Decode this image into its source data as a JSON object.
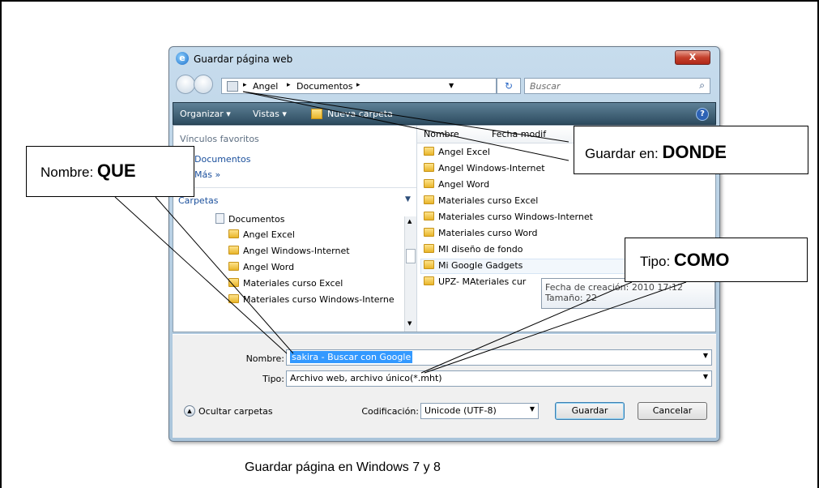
{
  "dialog": {
    "title": "Guardar página web",
    "close_glyph": "X",
    "address": {
      "segments": [
        "Angel",
        "Documentos"
      ],
      "sep": "▸"
    },
    "search_placeholder": "Buscar",
    "toolbar": {
      "organize": "Organizar ▾",
      "views": "Vistas ▾",
      "new_folder": "Nueva carpeta"
    },
    "favorites_header": "Vínculos favoritos",
    "favorites": [
      "Documentos",
      "Más »"
    ],
    "folders_header": "Carpetas",
    "tree": [
      "Documentos",
      "Angel Excel",
      "Angel Windows-Internet",
      "Angel Word",
      "Materiales curso Excel",
      "Materiales curso Windows-Interne"
    ],
    "columns": [
      "Nombre",
      "Fecha modif"
    ],
    "files": [
      "Angel Excel",
      "Angel Windows-Internet",
      "Angel Word",
      "Materiales curso Excel",
      "Materiales curso Windows-Internet",
      "Materiales curso Word",
      "MI diseño de fondo",
      "Mi Google Gadgets",
      "UPZ- MAteriales cur"
    ],
    "tooltip": {
      "created": "Fecha de creación: 2010 17:12",
      "size": "Tamaño: 22"
    },
    "name_label": "Nombre:",
    "name_value": "sakira - Buscar con Google",
    "type_label": "Tipo:",
    "type_value": "Archivo web, archivo único(*.mht)",
    "hide_folders": "Ocultar carpetas",
    "encoding_label": "Codificación:",
    "encoding_value": "Unicode (UTF-8)",
    "save_button": "Guardar",
    "cancel_button": "Cancelar"
  },
  "callouts": {
    "guardar": {
      "prefix": "Guardar en: ",
      "strong": "DONDE"
    },
    "nombre": {
      "prefix": "Nombre: ",
      "strong": "QUE"
    },
    "tipo": {
      "prefix": "Tipo: ",
      "strong": "COMO"
    }
  },
  "caption": "Guardar página en Windows 7 y 8",
  "colors": {
    "toolbar": "#3e5f74",
    "selection": "#3399ff"
  }
}
